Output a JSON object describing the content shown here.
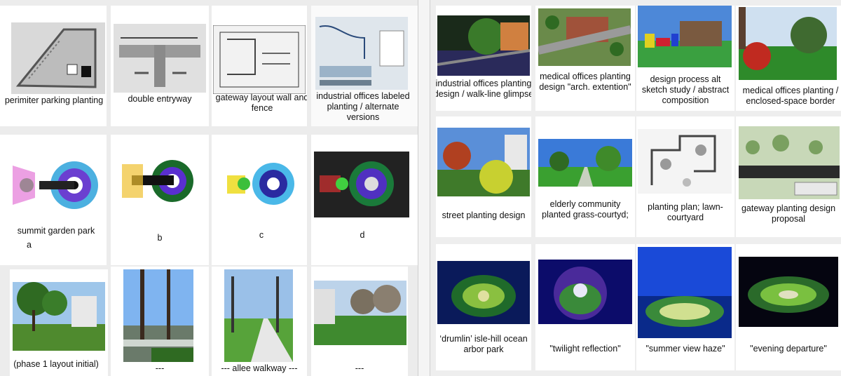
{
  "left_panel": {
    "row1": [
      {
        "caption": "perimiter parking planting",
        "icon": "site-plan-sketch"
      },
      {
        "caption": "double entryway",
        "icon": "entry-plan-sketch"
      },
      {
        "caption": "gateway layout wall and fence",
        "icon": "gateway-plan-sketch"
      },
      {
        "caption": "industrial offices labeled planting / alternate versions",
        "icon": "labeled-plan"
      }
    ],
    "row2": [
      {
        "caption": "summit garden park",
        "letter": "a"
      },
      {
        "caption": "",
        "letter": "b"
      },
      {
        "caption": "",
        "letter": "c"
      },
      {
        "caption": "",
        "letter": "d"
      }
    ],
    "row3": [
      {
        "caption": "(phase 1 layout initial)"
      },
      {
        "caption": "---"
      },
      {
        "caption": "--- allee walkway ---"
      },
      {
        "caption": "---"
      }
    ]
  },
  "right_panel": {
    "row1": [
      {
        "caption": "industrial offices planting design / walk-line glimpse"
      },
      {
        "caption": "medical offices planting design \"arch. extention\""
      },
      {
        "caption": "design process alt sketch study / abstract composition"
      },
      {
        "caption": "medical offices planting / enclosed-space border"
      }
    ],
    "row2": [
      {
        "caption": "street planting design"
      },
      {
        "caption": "elderly community planted grass-courtyd;"
      },
      {
        "caption": "planting plan; lawn-courtyard"
      },
      {
        "caption": "gateway planting design proposal"
      }
    ],
    "row3": [
      {
        "caption": "‘drumlin’ isle-hill ocean arbor park"
      },
      {
        "caption": "\"twilight reflection\""
      },
      {
        "caption": "\"summer view haze\""
      },
      {
        "caption": "\"evening departure\""
      }
    ]
  },
  "colors": {
    "background": "#ececec",
    "cell": "#ffffff",
    "night_blue": "#0a1a5a",
    "lawn_green": "#3c8a2c",
    "sky_blue": "#5a8fd8"
  }
}
